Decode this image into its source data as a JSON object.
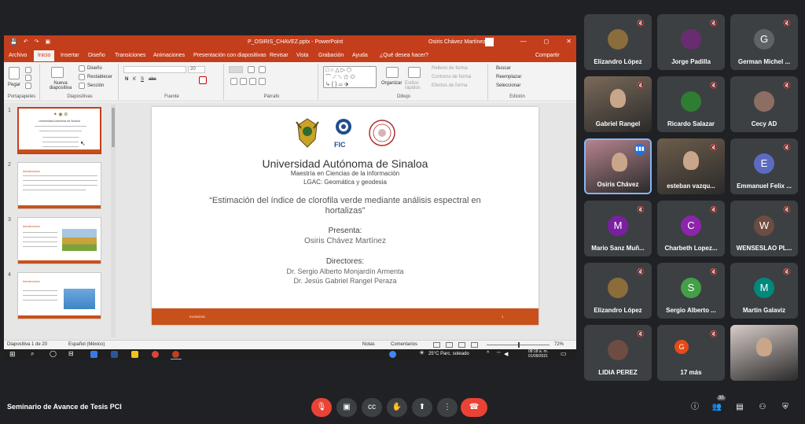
{
  "window": {
    "filename": "P_OSIRIS_CHAVEZ.pptx - PowerPoint",
    "user": "Osiris Chávez Martínez",
    "qat": [
      "💾",
      "↶",
      "↷",
      "▣"
    ],
    "win_controls": [
      "—",
      "◻",
      "✕"
    ]
  },
  "tabs": [
    "Archivo",
    "Inicio",
    "Insertar",
    "Diseño",
    "Transiciones",
    "Animaciones",
    "Presentación con diapositivas",
    "Revisar",
    "Vista",
    "Grabación",
    "Ayuda",
    "¿Qué desea hacer?",
    "Compartir"
  ],
  "ribbon": {
    "groups": [
      "Portapapeles",
      "Diapositivas",
      "Fuente",
      "Párrafo",
      "Dibujo",
      "Edición"
    ],
    "paste": "Pegar",
    "new_slide": "Nueva diapositiva",
    "layout": "Diseño",
    "reset": "Restablecer",
    "section": "Sección",
    "organize": "Organizar",
    "quick_styles": "Estilos rápidos",
    "fill": "Relleno de forma",
    "outline": "Contorno de forma",
    "effects": "Efectos de forma",
    "find": "Buscar",
    "replace": "Reemplazar",
    "select": "Seleccionar",
    "font_size": "20",
    "font_buttons": [
      "N",
      "K",
      "S",
      "abc"
    ]
  },
  "thumbnails": [
    {
      "num": "1",
      "title": "Universidad Autónoma de Sinaloa"
    },
    {
      "num": "2",
      "title": "Introducción"
    },
    {
      "num": "3",
      "title": "Introducción"
    },
    {
      "num": "4",
      "title": "Introducción"
    }
  ],
  "slide": {
    "university": "Universidad Autónoma de Sinaloa",
    "program": "Maestría en Ciencias de la información",
    "lgac": "LGAC: Geomática y geodesia",
    "thesis": "“Estimación del índice de clorofila verde mediante análisis espectral en hortalizas”",
    "presenta_label": "Presenta:",
    "presenter": "Osiris Chávez Martínez",
    "directores_label": "Directores:",
    "director1": "Dr. Sergio Alberto Monjardín Armenta",
    "director2": "Dr. Jesús Gabriel Rangel Peraza",
    "fic": "FIC",
    "footer_left": "01/09/2021",
    "footer_right": "1"
  },
  "status": {
    "slide_of": "Diapositiva 1 de 20",
    "language": "Español (México)",
    "notes": "Notas",
    "comments": "Comentarios",
    "zoom": "72%"
  },
  "taskbar": {
    "weather": "25°C  Parc. soleado",
    "time": "08:18 a. m.",
    "date": "01/09/2021"
  },
  "participants": [
    {
      "name": "Elizandro López",
      "initial": "",
      "color": "#8a6d3b",
      "type": "photo"
    },
    {
      "name": "Jorge Padilla",
      "initial": "",
      "color": "#6a2c70",
      "type": "photo"
    },
    {
      "name": "German Michel ...",
      "initial": "G",
      "color": "#5f6368",
      "type": "initial"
    },
    {
      "name": "Gabriel Rangel",
      "initial": "",
      "color": "#7a6a5a",
      "type": "video"
    },
    {
      "name": "Ricardo Salazar",
      "initial": "",
      "color": "#2e7d32",
      "type": "photo"
    },
    {
      "name": "Cecy AD",
      "initial": "",
      "color": "#8d6e63",
      "type": "photo"
    },
    {
      "name": "Osiris Chávez",
      "initial": "",
      "color": "#b5838d",
      "type": "video"
    },
    {
      "name": "esteban vazqu...",
      "initial": "",
      "color": "#6d5d4b",
      "type": "video"
    },
    {
      "name": "Emmanuel Felix ...",
      "initial": "E",
      "color": "#5c6bc0",
      "type": "initial"
    },
    {
      "name": "Mario Sanz Muñ...",
      "initial": "M",
      "color": "#7b1fa2",
      "type": "initial"
    },
    {
      "name": "Charbeth Lopez...",
      "initial": "C",
      "color": "#8e24aa",
      "type": "initial"
    },
    {
      "name": "WENSESLAO PL...",
      "initial": "W",
      "color": "#6d4c41",
      "type": "initial"
    },
    {
      "name": "Elizandro López",
      "initial": "",
      "color": "#8a6d3b",
      "type": "photo"
    },
    {
      "name": "Sergio Alberto ...",
      "initial": "S",
      "color": "#43a047",
      "type": "initial"
    },
    {
      "name": "Martin Galaviz",
      "initial": "M",
      "color": "#00897b",
      "type": "initial"
    },
    {
      "name": "LIDIA PEREZ",
      "initial": "",
      "color": "#6d4c41",
      "type": "photo"
    },
    {
      "name": "17 más",
      "initial": "G",
      "color": "#e64a19",
      "type": "more"
    },
    {
      "name": "",
      "initial": "",
      "color": "#d7ccc8",
      "type": "video"
    }
  ],
  "meeting": {
    "title": "Seminario de Avance de Tesis PCI",
    "participant_count": "35"
  }
}
